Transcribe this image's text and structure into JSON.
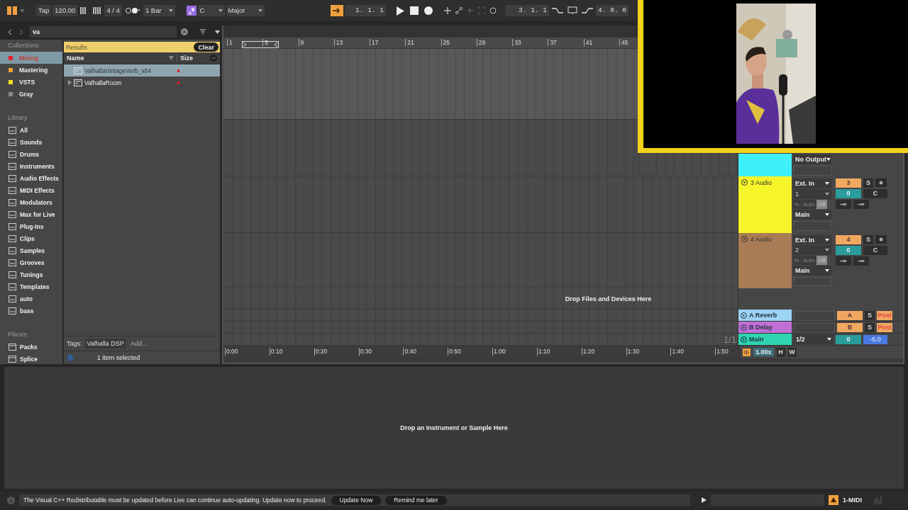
{
  "transport": {
    "tap": "Tap",
    "tempo": "120.00",
    "signature": "4 / 4",
    "quantize": "1 Bar",
    "key": "C",
    "scale": "Major",
    "position": "1. 1. 1",
    "loop_start": "3. 1. 1",
    "loop_length": "4. 0. 0"
  },
  "browser": {
    "search": "va",
    "collections_heading": "Collections",
    "collections": [
      {
        "label": "Mixing",
        "color": "#e0202a",
        "selected": true
      },
      {
        "label": "Mastering",
        "color": "#f0a030",
        "selected": false
      },
      {
        "label": "VSTS",
        "color": "#f0e020",
        "selected": false
      },
      {
        "label": "Gray",
        "color": "#8a8a8a",
        "selected": false
      }
    ],
    "library_heading": "Library",
    "library": [
      "All",
      "Sounds",
      "Drums",
      "Instruments",
      "Audio Effects",
      "MIDI Effects",
      "Modulators",
      "Max for Live",
      "Plug-Ins",
      "Clips",
      "Samples",
      "Grooves",
      "Tunings",
      "Templates",
      "auto",
      "bass"
    ],
    "places_heading": "Places",
    "places": [
      "Packs",
      "Splice"
    ],
    "results_title": "Results",
    "clear": "Clear",
    "columns": [
      "Name",
      "Size"
    ],
    "results": [
      {
        "name": "ValhallaVintageVerb_x64",
        "selected": true,
        "expandable": false
      },
      {
        "name": "ValhallaRoom",
        "selected": false,
        "expandable": true
      }
    ],
    "tags_label": "Tags:",
    "tags": [
      "Valhalla DSP"
    ],
    "tag_placeholder": "Add...",
    "status": "1 item selected"
  },
  "arrangement": {
    "bars": [
      "1",
      "5",
      "9",
      "13",
      "17",
      "21",
      "25",
      "29",
      "33",
      "37",
      "41",
      "45"
    ],
    "times": [
      "0:00",
      "0:10",
      "0:20",
      "0:30",
      "0:40",
      "0:50",
      "1:00",
      "1:10",
      "1:20",
      "1:30",
      "1:40",
      "1:50"
    ],
    "drop_hint": "Drop Files and Devices Here",
    "tracks": [
      {
        "selected": true
      },
      {
        "selected": false,
        "color": "#3ff0fa",
        "output": "No Output"
      },
      {
        "selected": false,
        "name": "3 Audio",
        "color": "#f5f52a",
        "input": "Ext. In",
        "channel": "1",
        "monitor": [
          {
            "label": "In",
            "selected": false
          },
          {
            "label": "Auto",
            "selected": false
          },
          {
            "label": "Off",
            "selected": true
          }
        ],
        "output": "Main",
        "number": "3",
        "solo": "S",
        "volume": "0",
        "pan": "C",
        "peaks": [
          "-∞",
          "-∞"
        ]
      },
      {
        "selected": false,
        "name": "4 Audio",
        "color": "#a87c54",
        "input": "Ext. In",
        "channel": "2",
        "monitor": [
          {
            "label": "In",
            "selected": false
          },
          {
            "label": "Auto",
            "selected": false
          },
          {
            "label": "Off",
            "selected": true
          }
        ],
        "output": "Main",
        "number": "4",
        "solo": "S",
        "volume": "0",
        "pan": "C",
        "peaks": [
          "-∞",
          "-∞"
        ]
      }
    ],
    "returns": [
      {
        "name": "A Reverb",
        "color": "#9dd3f5",
        "send": "A",
        "solo": "S",
        "post": "Post"
      },
      {
        "name": "B Delay",
        "color": "#c06fd5",
        "send": "B",
        "solo": "S",
        "post": "Post"
      }
    ],
    "main": {
      "name": "Main",
      "color": "#2ed5b0",
      "page": "1/1",
      "output": "1/2",
      "volume": "0",
      "gain": "-6.0"
    },
    "zoom": "1.00x",
    "h": "H",
    "w": "W"
  },
  "detail": {
    "drop_hint": "Drop an Instrument or Sample Here"
  },
  "notice": {
    "message": "The Visual C++ Redistributable must be updated before Live can continue auto-updating. Update now to proceed.",
    "buttons": [
      "Update Now",
      "Remind me later"
    ]
  },
  "status": {
    "track": "1-MIDI"
  }
}
